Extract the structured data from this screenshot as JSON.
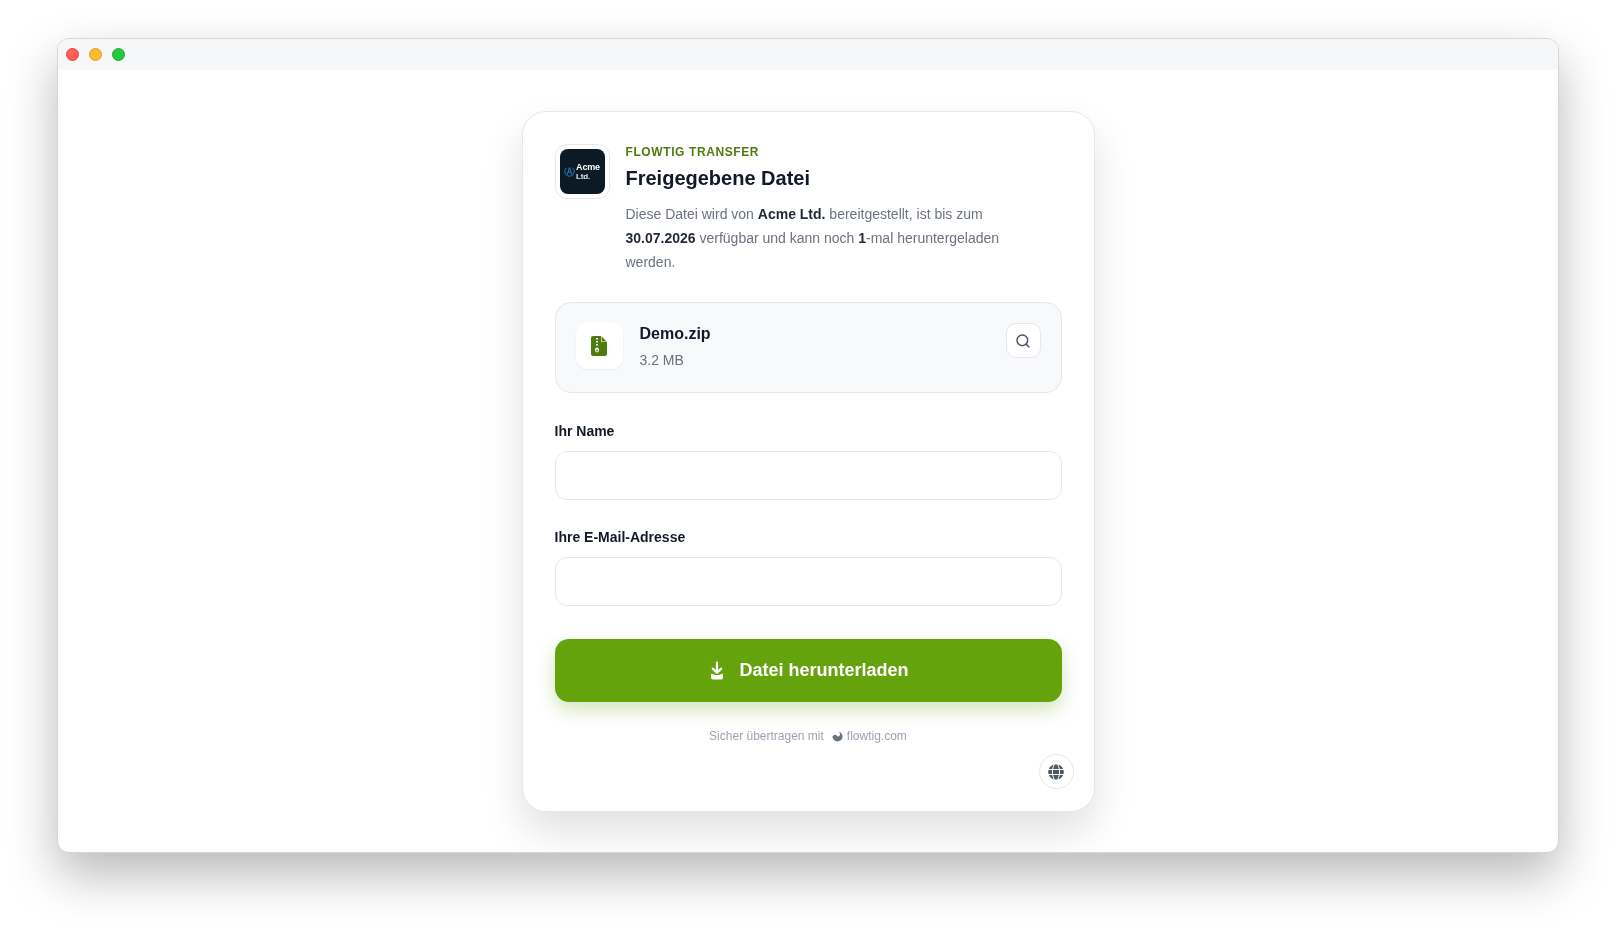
{
  "card": {
    "logo": {
      "name": "Acme",
      "suffix": "Ltd."
    },
    "eyebrow": "FLOWTIG TRANSFER",
    "title": "Freigegebene Datei",
    "description": "Diese Datei wird von **Acme Ltd.** bereitgestellt, ist bis zum **30.07.2026** verfügbar und kann noch **1**-mal heruntergeladen werden."
  },
  "file": {
    "name": "Demo.zip",
    "size": "3.2 MB"
  },
  "form": {
    "fields": [
      {
        "label": "Ihr Name"
      },
      {
        "label": "Ihre E-Mail-Adresse"
      }
    ]
  },
  "download_button": {
    "label": "Datei herunterladen"
  },
  "footer": {
    "text": "Sicher übertragen mit",
    "link": "flowtig.com"
  }
}
